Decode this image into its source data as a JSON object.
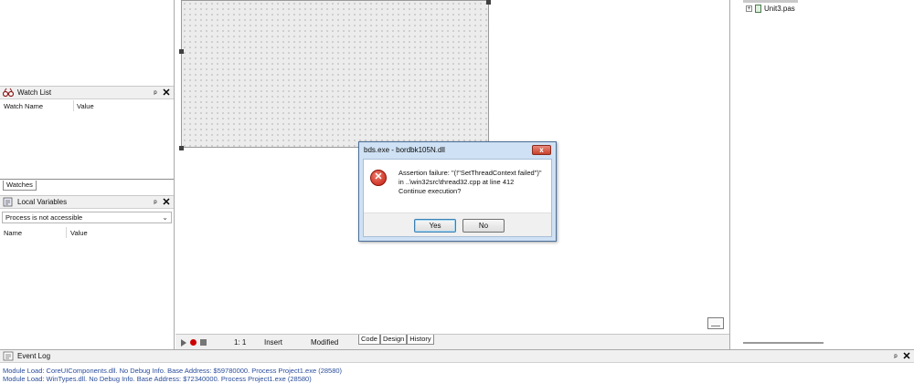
{
  "watch_list": {
    "title": "Watch List",
    "columns": [
      "Watch Name",
      "Value"
    ],
    "tab": "Watches"
  },
  "local_variables": {
    "title": "Local Variables",
    "dropdown_value": "Process is not accessible",
    "columns": [
      "Name",
      "Value"
    ]
  },
  "panel_buttons": {
    "pin": "ᵖ",
    "close": "✕"
  },
  "project_tree": {
    "items": [
      {
        "label": "Unit3.pas"
      }
    ]
  },
  "status_bar": {
    "position": "1:  1",
    "mode": "Insert",
    "state": "Modified",
    "tabs": [
      "Code",
      "Design",
      "History"
    ]
  },
  "event_log": {
    "title": "Event Log",
    "lines": [
      "Module Load: CoreUIComponents.dll. No Debug Info. Base Address: $59780000. Process Project1.exe (28580)",
      "Module Load: WinTypes.dll. No Debug Info. Base Address: $72340000. Process Project1.exe (28580)"
    ]
  },
  "dialog": {
    "title": "bds.exe - bordbk105N.dll",
    "close_glyph": "x",
    "icon_glyph": "✕",
    "message_lines": [
      "Assertion failure: \"(!\"SetThreadContext failed\")\"",
      "in ..\\win32src\\thread32.cpp at line 412",
      "Continue execution?"
    ],
    "yes_label": "Yes",
    "no_label": "No"
  },
  "colors": {
    "dialog_frame": "#cfe1f4",
    "error_red": "#c31c10",
    "log_text": "#2a4d9b"
  }
}
